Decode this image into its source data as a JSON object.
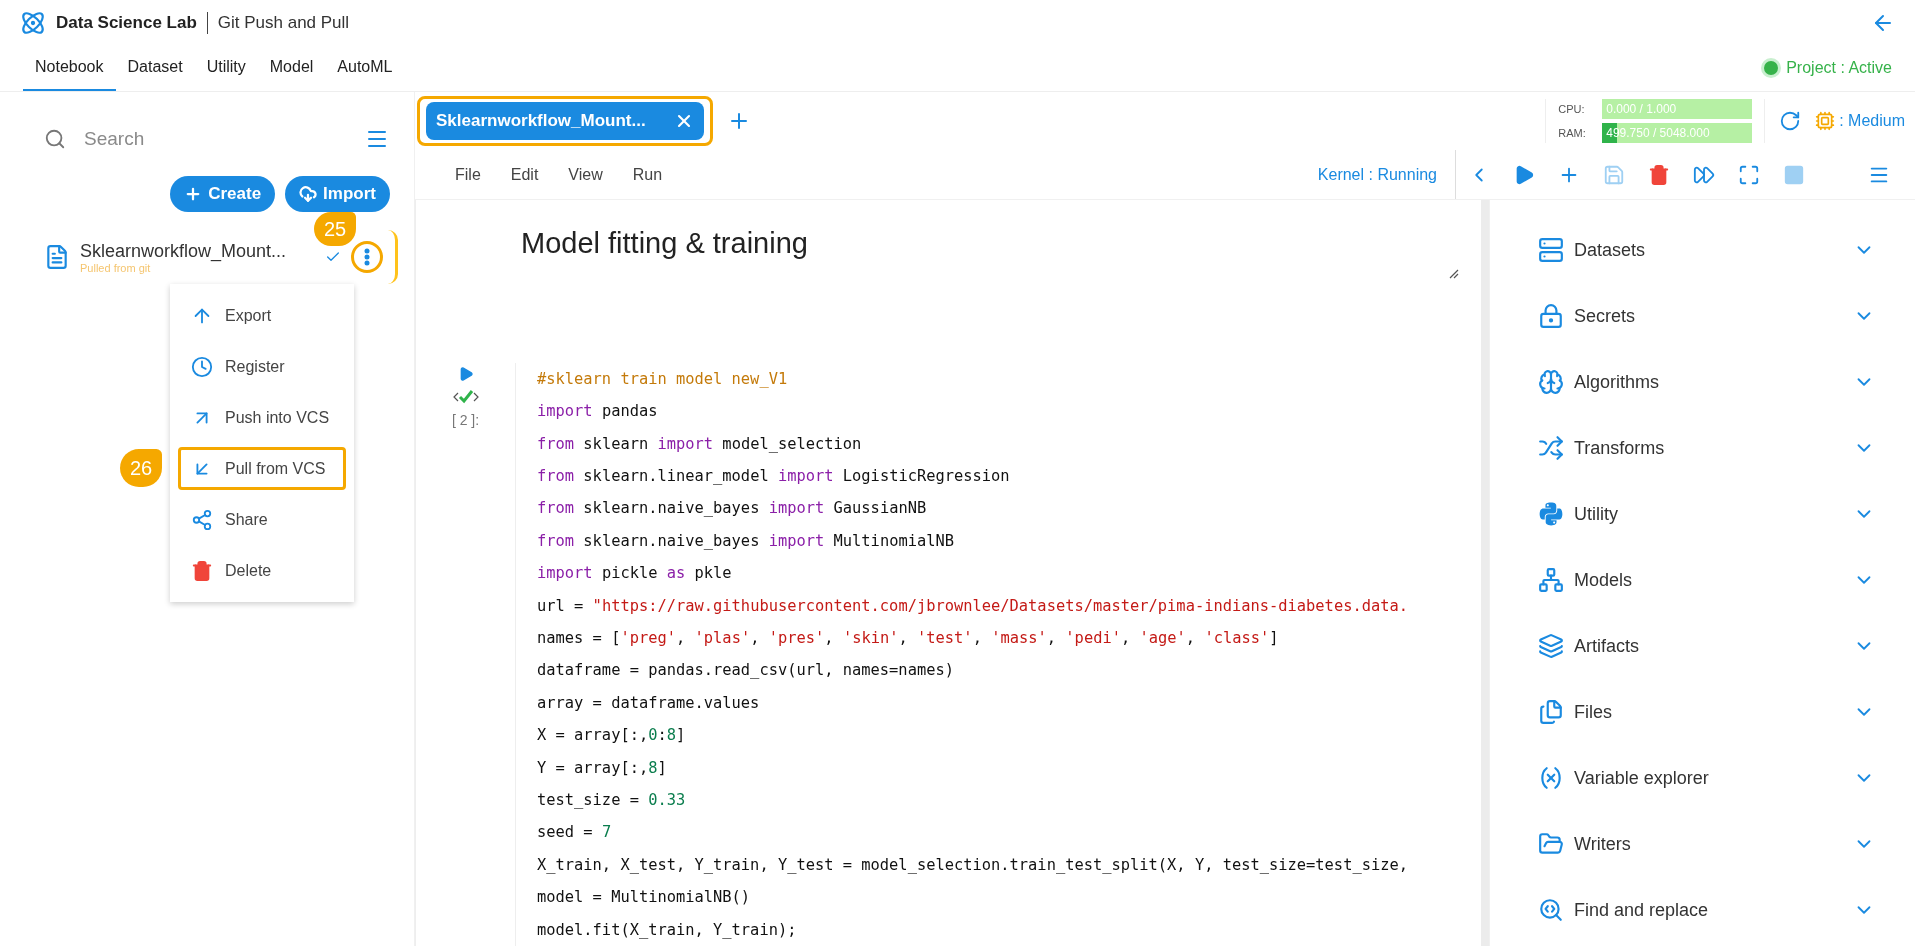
{
  "app": {
    "name": "Data Science Lab",
    "page_title": "Git Push and Pull"
  },
  "nav_tabs": [
    {
      "label": "Notebook",
      "selected": true
    },
    {
      "label": "Dataset",
      "selected": false
    },
    {
      "label": "Utility",
      "selected": false
    },
    {
      "label": "Model",
      "selected": false
    },
    {
      "label": "AutoML",
      "selected": false
    }
  ],
  "project_status": {
    "label": "Project : Active",
    "active": true
  },
  "sidebar": {
    "search": {
      "placeholder": "Search"
    },
    "buttons": [
      {
        "label": "Create",
        "kind": "create"
      },
      {
        "label": "Import",
        "kind": "import"
      }
    ],
    "notebook": {
      "name": "Sklearnworkflow_Mount...",
      "subtitle": "Pulled from git",
      "highlighted": true,
      "callout": "25"
    },
    "menu": [
      {
        "label": "Export",
        "kind": "export",
        "highlighted": false
      },
      {
        "label": "Register",
        "kind": "register",
        "highlighted": false
      },
      {
        "label": "Push into VCS",
        "kind": "push",
        "highlighted": false
      },
      {
        "label": "Pull from VCS",
        "kind": "pull",
        "highlighted": true,
        "callout": "26"
      },
      {
        "label": "Share",
        "kind": "share",
        "highlighted": false
      },
      {
        "label": "Delete",
        "kind": "delete",
        "highlighted": false
      }
    ]
  },
  "notebook_tabs": [
    {
      "label": "Sklearnworkflow_Mount...",
      "selected": true,
      "highlighted": true
    }
  ],
  "resources": [
    {
      "label": "CPU:",
      "reading": "0.000 / 1.000"
    },
    {
      "label": "RAM:",
      "reading": "499.750 / 5048.000",
      "level": 0.099
    }
  ],
  "compute": {
    "label": ": Medium"
  },
  "menu_bar": [
    "File",
    "Edit",
    "View",
    "Run"
  ],
  "kernel_status": "Kernel : Running",
  "toolbar": [
    {
      "kind": "prev",
      "disabled": false
    },
    {
      "kind": "run",
      "disabled": false
    },
    {
      "kind": "add",
      "disabled": false
    },
    {
      "kind": "save",
      "disabled": true
    },
    {
      "kind": "delete",
      "disabled": false
    },
    {
      "kind": "run-all",
      "disabled": false
    },
    {
      "kind": "fullscreen",
      "disabled": false
    },
    {
      "kind": "stop",
      "disabled": true
    },
    {
      "kind": "menu",
      "disabled": false
    }
  ],
  "markdown_cell": {
    "text": "Model fitting & training"
  },
  "code_cell": {
    "prompt": "[ 2 ]:",
    "succeeded": true,
    "lines": [
      [
        {
          "text": "#sklearn train model new_V1",
          "kind": "comment"
        }
      ],
      [
        {
          "text": "import",
          "kind": "keyword"
        },
        {
          "text": " pandas",
          "kind": "plain"
        }
      ],
      [
        {
          "text": "from",
          "kind": "keyword"
        },
        {
          "text": " sklearn ",
          "kind": "plain"
        },
        {
          "text": "import",
          "kind": "keyword"
        },
        {
          "text": " model_selection",
          "kind": "plain"
        }
      ],
      [
        {
          "text": "from",
          "kind": "keyword"
        },
        {
          "text": " sklearn.linear_model ",
          "kind": "plain"
        },
        {
          "text": "import",
          "kind": "keyword"
        },
        {
          "text": " LogisticRegression",
          "kind": "plain"
        }
      ],
      [
        {
          "text": "from",
          "kind": "keyword"
        },
        {
          "text": " sklearn.naive_bayes ",
          "kind": "plain"
        },
        {
          "text": "import",
          "kind": "keyword"
        },
        {
          "text": " GaussianNB",
          "kind": "plain"
        }
      ],
      [
        {
          "text": "from",
          "kind": "keyword"
        },
        {
          "text": " sklearn.naive_bayes ",
          "kind": "plain"
        },
        {
          "text": "import",
          "kind": "keyword"
        },
        {
          "text": " MultinomialNB",
          "kind": "plain"
        }
      ],
      [
        {
          "text": "import",
          "kind": "keyword"
        },
        {
          "text": " pickle ",
          "kind": "plain"
        },
        {
          "text": "as",
          "kind": "keyword"
        },
        {
          "text": " pkle",
          "kind": "plain"
        }
      ],
      [
        {
          "text": "url = ",
          "kind": "plain"
        },
        {
          "text": "\"https://raw.githubusercontent.com/jbrownlee/Datasets/master/pima-indians-diabetes.data.",
          "kind": "string"
        }
      ],
      [
        {
          "text": "names = [",
          "kind": "plain"
        },
        {
          "text": "'preg'",
          "kind": "string"
        },
        {
          "text": ", ",
          "kind": "plain"
        },
        {
          "text": "'plas'",
          "kind": "string"
        },
        {
          "text": ", ",
          "kind": "plain"
        },
        {
          "text": "'pres'",
          "kind": "string"
        },
        {
          "text": ", ",
          "kind": "plain"
        },
        {
          "text": "'skin'",
          "kind": "string"
        },
        {
          "text": ", ",
          "kind": "plain"
        },
        {
          "text": "'test'",
          "kind": "string"
        },
        {
          "text": ", ",
          "kind": "plain"
        },
        {
          "text": "'mass'",
          "kind": "string"
        },
        {
          "text": ", ",
          "kind": "plain"
        },
        {
          "text": "'pedi'",
          "kind": "string"
        },
        {
          "text": ", ",
          "kind": "plain"
        },
        {
          "text": "'age'",
          "kind": "string"
        },
        {
          "text": ", ",
          "kind": "plain"
        },
        {
          "text": "'class'",
          "kind": "string"
        },
        {
          "text": "]",
          "kind": "plain"
        }
      ],
      [
        {
          "text": "dataframe = pandas.read_csv(url, names=names)",
          "kind": "plain"
        }
      ],
      [
        {
          "text": "array = dataframe.values",
          "kind": "plain"
        }
      ],
      [
        {
          "text": "X = array[:,",
          "kind": "plain"
        },
        {
          "text": "0",
          "kind": "number"
        },
        {
          "text": ":",
          "kind": "plain"
        },
        {
          "text": "8",
          "kind": "number"
        },
        {
          "text": "]",
          "kind": "plain"
        }
      ],
      [
        {
          "text": "Y = array[:,",
          "kind": "plain"
        },
        {
          "text": "8",
          "kind": "number"
        },
        {
          "text": "]",
          "kind": "plain"
        }
      ],
      [
        {
          "text": "test_size = ",
          "kind": "plain"
        },
        {
          "text": "0.33",
          "kind": "number"
        }
      ],
      [
        {
          "text": "seed = ",
          "kind": "plain"
        },
        {
          "text": "7",
          "kind": "number"
        }
      ],
      [
        {
          "text": "X_train, X_test, Y_train, Y_test = model_selection.train_test_split(X, Y, test_size=test_size,",
          "kind": "plain"
        }
      ],
      [
        {
          "text": "model = MultinomialNB()",
          "kind": "plain"
        }
      ],
      [
        {
          "text": "model.fit(X_train, Y_train);",
          "kind": "plain"
        }
      ]
    ]
  },
  "right_panel": [
    {
      "label": "Datasets",
      "kind": "datasets",
      "expanded": false
    },
    {
      "label": "Secrets",
      "kind": "secrets",
      "expanded": false
    },
    {
      "label": "Algorithms",
      "kind": "algorithms",
      "expanded": false
    },
    {
      "label": "Transforms",
      "kind": "transforms",
      "expanded": false
    },
    {
      "label": "Utility",
      "kind": "utility",
      "expanded": false
    },
    {
      "label": "Models",
      "kind": "models",
      "expanded": false
    },
    {
      "label": "Artifacts",
      "kind": "artifacts",
      "expanded": false
    },
    {
      "label": "Files",
      "kind": "files",
      "expanded": false
    },
    {
      "label": "Variable explorer",
      "kind": "variables",
      "expanded": false
    },
    {
      "label": "Writers",
      "kind": "writers",
      "expanded": false
    },
    {
      "label": "Find and replace",
      "kind": "find",
      "expanded": false
    }
  ]
}
